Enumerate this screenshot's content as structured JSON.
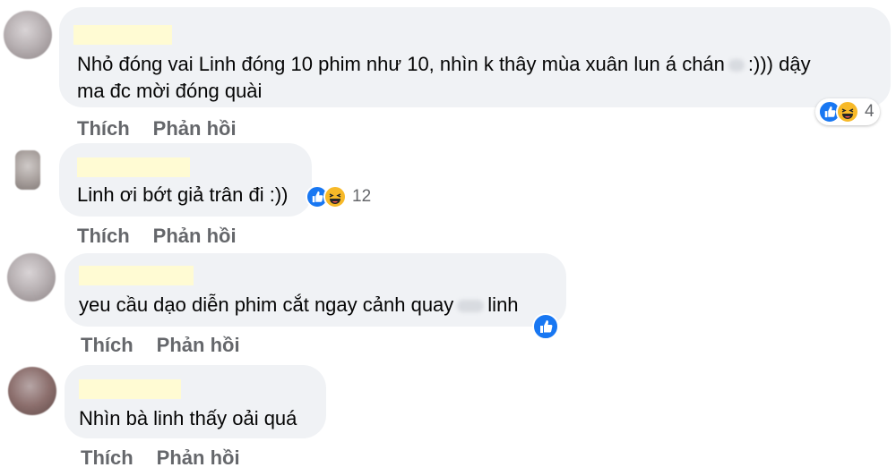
{
  "comments": [
    {
      "text_line1": "Nhỏ đóng vai Linh đóng 10 phim như 10, nhìn k thây mùa xuân lun á chán",
      "text_line1_end": ":))) dậy",
      "text_line2": "ma đc mời đóng quài",
      "reaction_count": "4",
      "like_label": "Thích",
      "reply_label": "Phản hồi"
    },
    {
      "text_line1": "Linh ơi bớt giả trân đi :))",
      "reaction_count": "12",
      "like_label": "Thích",
      "reply_label": "Phản hồi"
    },
    {
      "text_line1": "yeu cầu dạo diễn phim cắt ngay cảnh quay",
      "text_line1_end": "linh",
      "like_label": "Thích",
      "reply_label": "Phản hồi"
    },
    {
      "text_line1": "Nhìn bà linh thấy oải quá",
      "like_label": "Thích",
      "reply_label": "Phản hồi"
    }
  ],
  "colors": {
    "bubble": "#f0f2f5",
    "name_redaction": "#fffbd3",
    "action_text": "#65676b",
    "like_blue": "#1877f2",
    "haha_yellow": "#f7b928"
  },
  "icons": [
    "like-reaction-icon",
    "haha-reaction-icon"
  ]
}
